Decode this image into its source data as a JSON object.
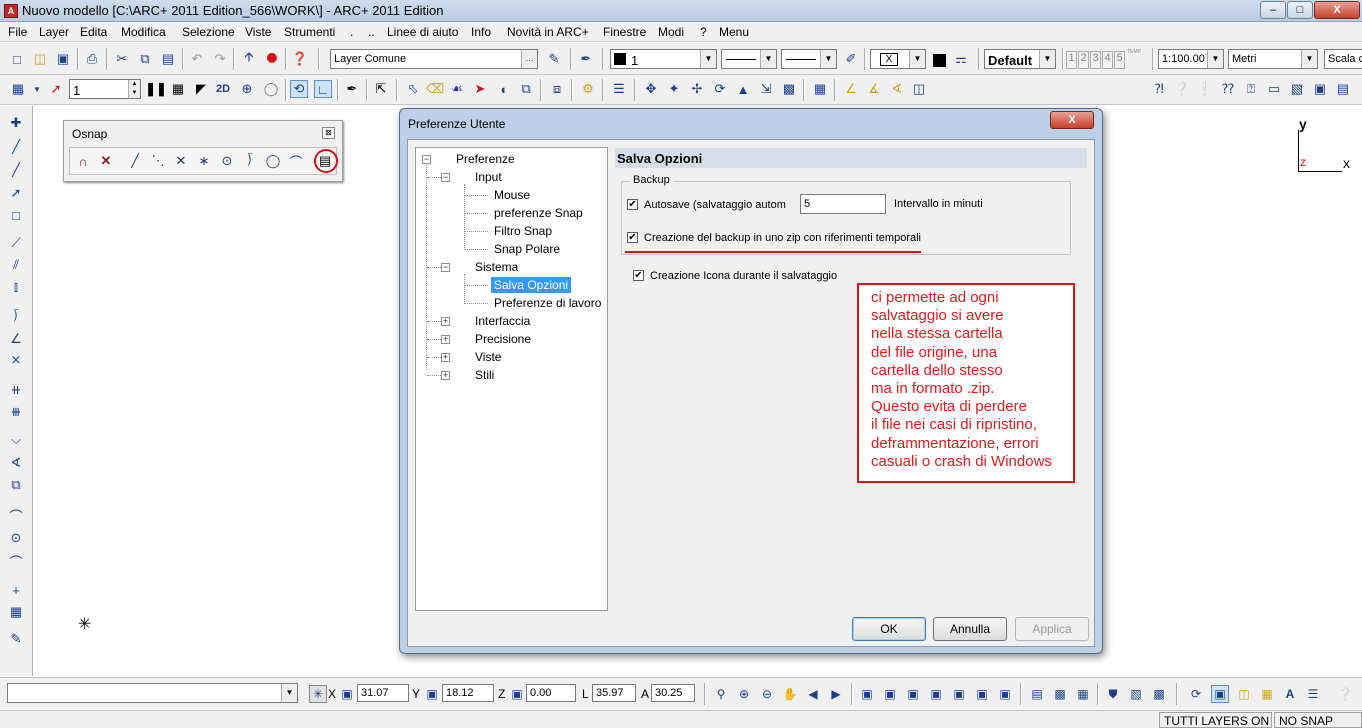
{
  "window": {
    "title": "Nuovo modello [C:\\ARC+ 2011 Edition_566\\WORK\\] - ARC+ 2011 Edition",
    "app_icon_glyph": "A",
    "min_glyph": "–",
    "max_glyph": "□",
    "close_glyph": "X"
  },
  "menu": [
    "File",
    "Layer",
    "Edita",
    "Modifica",
    "Selezione",
    "Viste",
    "Strumenti",
    ".",
    "..",
    "Linee di aiuto",
    "Info",
    "Novità in ARC+",
    "Finestre",
    "Modi",
    "?",
    "Menu"
  ],
  "toolbar1": {
    "layer_combo": "Layer Comune",
    "color_combo": "1",
    "x_box": "X",
    "style_combo": "Default",
    "scale_buttons": [
      "1",
      "2",
      "3",
      "4",
      "5"
    ],
    "temp_label": "TEMP",
    "scale_combo": "1:100.00",
    "units_combo": "Metri",
    "scala_label": "Scala c"
  },
  "toolbar2": {
    "number_field": "1",
    "label_2d": "2D"
  },
  "osnap": {
    "title": "Osnap",
    "close_glyph": "⊠"
  },
  "dialog": {
    "title": "Preferenze Utente",
    "close_glyph": "X",
    "tree": {
      "root": "Preferenze",
      "input": "Input",
      "input_children": [
        "Mouse",
        "preferenze Snap",
        "Filtro Snap",
        "Snap Polare"
      ],
      "sistema": "Sistema",
      "sistema_children": [
        "Salva Opzioni",
        "Preferenze di lavoro"
      ],
      "collapsed": [
        "Interfaccia",
        "Precisione",
        "Viste",
        "Stili"
      ],
      "minus_glyph": "−",
      "plus_glyph": "+"
    },
    "panel_title": "Salva Opzioni",
    "backup": {
      "legend": "Backup",
      "autosave_label": "Autosave (salvataggio autom",
      "autosave_value": "5",
      "interval_label": "Intervallo in minuti",
      "zip_label": "Creazione del backup in uno zip con riferimenti temporali"
    },
    "icon_label": "Creazione Icona durante il salvataggio",
    "check_glyph": "✔",
    "note_lines": [
      "ci permette ad ogni",
      "salvataggio si avere",
      "nella stessa cartella",
      "del file origine, una",
      "cartella dello stesso",
      "ma in formato .zip.",
      "Questo evita di perdere",
      "il file nei casi di ripristino,",
      "deframmentazione, errori",
      "casuali o crash di Windows"
    ],
    "ok": "OK",
    "cancel": "Annulla",
    "apply": "Applica"
  },
  "ucs": {
    "y": "y",
    "z": "z",
    "x": "x"
  },
  "coords": {
    "x_label": "X",
    "x": "31.07",
    "y_label": "Y",
    "y": "18.12",
    "z_label": "Z",
    "z": "0.00",
    "l_label": "L",
    "l": "35.97",
    "a_label": "A",
    "a": "30.25"
  },
  "status": {
    "layers": "TUTTI LAYERS ON",
    "snap": "NO SNAP"
  },
  "colors": {
    "accent_red": "#d41414",
    "selection_blue": "#3399ff",
    "dialog_frame": "#bcd0e8"
  }
}
